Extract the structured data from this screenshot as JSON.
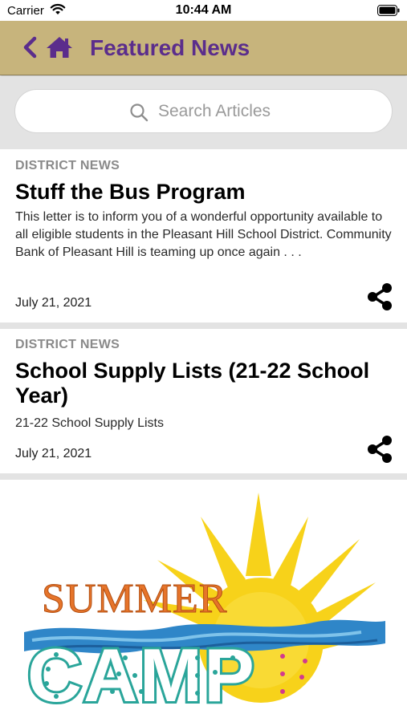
{
  "status_bar": {
    "carrier": "Carrier",
    "time": "10:44 AM"
  },
  "nav": {
    "title": "Featured News",
    "back_icon": "chevron-left-icon",
    "home_icon": "home-icon"
  },
  "search": {
    "placeholder": "Search Articles"
  },
  "articles": [
    {
      "category": "DISTRICT NEWS",
      "title": "Stuff the Bus Program",
      "summary": "This letter is to inform you of a wonderful opportunity available to all eligible students in the Pleasant Hill School District. Community Bank of Pleasant Hill is teaming up once again . . .",
      "date": "July 21, 2021"
    },
    {
      "category": "DISTRICT NEWS",
      "title": "School Supply Lists (21-22 School Year)",
      "summary": "21-22 School Supply Lists",
      "date": "July 21, 2021"
    }
  ],
  "featured": {
    "line1": "SUMMER",
    "line2": "CAMP"
  },
  "colors": {
    "nav_background": "#c7b47c",
    "nav_accent": "#5b2d8c",
    "category_gray": "#8a8a8a",
    "sun_yellow": "#f7d21a"
  }
}
